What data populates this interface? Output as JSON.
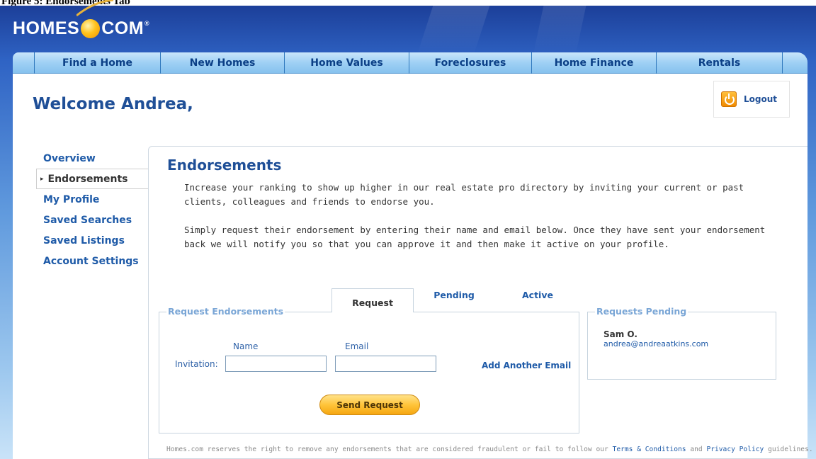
{
  "caption": "Figure 5: Endorsements Tab",
  "logo": {
    "left": "HOMES",
    "right": "COM",
    "mark": "®"
  },
  "nav": [
    {
      "label": "Find a Home"
    },
    {
      "label": "New Homes"
    },
    {
      "label": "Home Values"
    },
    {
      "label": "Foreclosures"
    },
    {
      "label": "Home Finance"
    },
    {
      "label": "Rentals"
    }
  ],
  "header": {
    "welcome": "Welcome Andrea,",
    "logout": "Logout",
    "logout_icon": "power-icon"
  },
  "sidebar": {
    "items": [
      {
        "label": "Overview"
      },
      {
        "label": "Endorsements"
      },
      {
        "label": "My Profile"
      },
      {
        "label": "Saved Searches"
      },
      {
        "label": "Saved Listings"
      },
      {
        "label": "Account Settings"
      }
    ],
    "active_marker": "▸"
  },
  "main": {
    "title": "Endorsements",
    "para1": "Increase your ranking to show up higher in our real estate pro directory by inviting your current or past clients, colleagues and friends to endorse you.",
    "para2": "Simply request their endorsement by entering their name and email below. Once they have sent your endorsement back we will notify you so that you can approve it and then make it active on your profile.",
    "tabs": [
      {
        "label": "Request"
      },
      {
        "label": "Pending"
      },
      {
        "label": "Active"
      }
    ],
    "request_box": {
      "legend": "Request Endorsements",
      "name_label": "Name",
      "email_label": "Email",
      "invitation_label": "Invitation:",
      "name_value": "",
      "email_value": "",
      "add_email": "Add Another Email",
      "send_button": "Send Request"
    },
    "pending_box": {
      "legend": "Requests Pending",
      "name": "Sam O.",
      "email": "andrea@andreaatkins.com"
    },
    "footer": {
      "text1": "Homes.com reserves the right to remove any endorsements that are considered fraudulent or fail to follow our ",
      "link1": "Terms & Conditions",
      "text2": " and ",
      "link2": "Privacy Policy",
      "text3": " guidelines."
    }
  }
}
